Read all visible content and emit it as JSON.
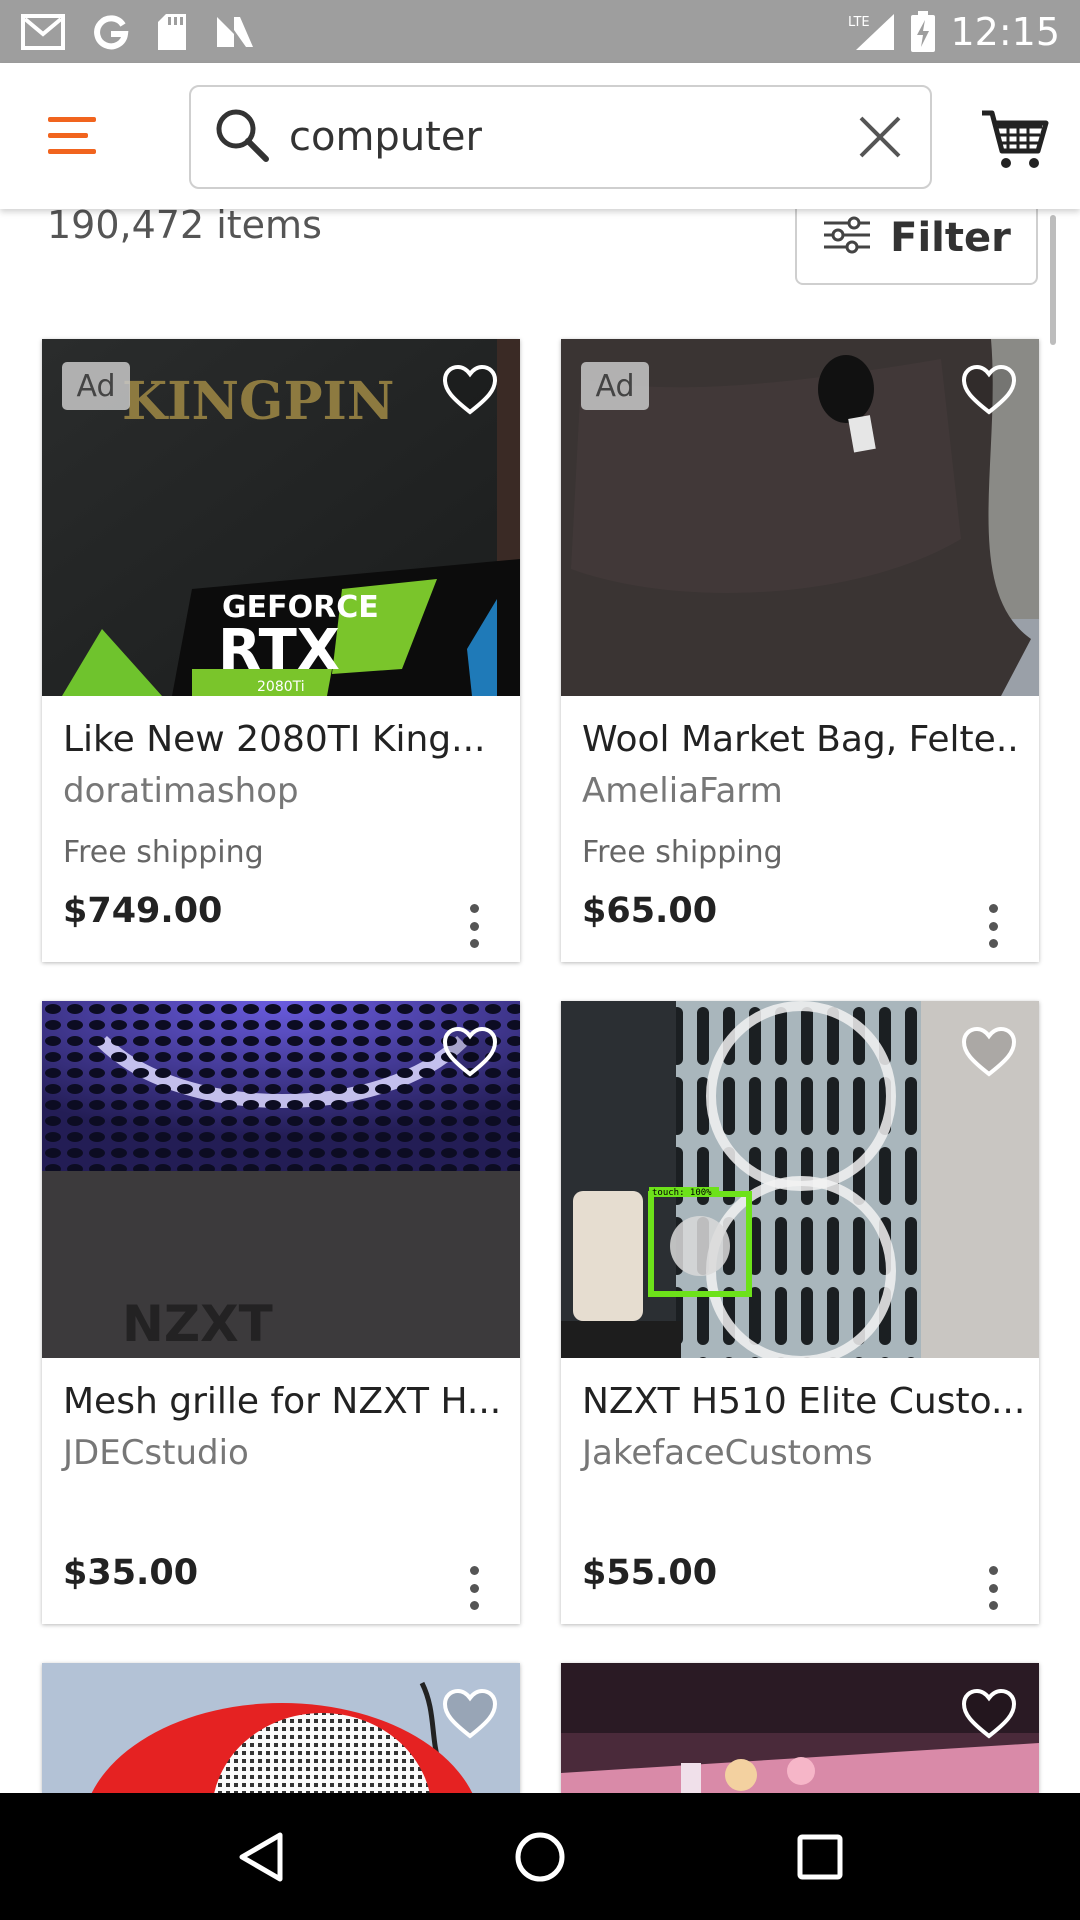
{
  "status_bar": {
    "time": "12:15",
    "network": "LTE",
    "icons": [
      "gmail-icon",
      "google-icon",
      "sd-card-icon",
      "n-app-icon"
    ]
  },
  "app_bar": {
    "menu_icon": "hamburger-menu-icon",
    "search": {
      "value": "computer",
      "icon": "search-icon",
      "clear_icon": "close-icon"
    },
    "cart_icon": "shopping-cart-icon",
    "accent_color": "#F1641E"
  },
  "results": {
    "count_label": "190,472 items",
    "filter_label": "Filter",
    "filter_icon": "sliders-icon"
  },
  "listings": [
    {
      "title": "Like New 2080TI King...",
      "shop": "doratimashop",
      "shipping": "Free shipping",
      "price": "$749.00",
      "ad": "Ad",
      "image": "gpu-box-photo"
    },
    {
      "title": "Wool Market Bag, Felte...",
      "shop": "AmeliaFarm",
      "shipping": "Free shipping",
      "price": "$65.00",
      "ad": "Ad",
      "image": "felt-bag-photo"
    },
    {
      "title": "Mesh grille for NZXT H...",
      "shop": "JDECstudio",
      "shipping": "",
      "price": "$35.00",
      "ad": "",
      "image": "nzxt-mesh-photo",
      "image_text": "NZXT"
    },
    {
      "title": "NZXT H510 Elite Custo...",
      "shop": "JakefaceCustoms",
      "shipping": "",
      "price": "$55.00",
      "ad": "",
      "image": "pc-case-photo",
      "overlay_text": "touch: 100%"
    },
    {
      "title": "",
      "shop": "",
      "shipping": "",
      "price": "",
      "ad": "",
      "image": "red-speaker-photo"
    },
    {
      "title": "",
      "shop": "",
      "shipping": "",
      "price": "",
      "ad": "",
      "image": "desk-setup-photo"
    }
  ],
  "gpu_box_text": {
    "brand": "KINGPIN",
    "line1": "GEFORCE",
    "line2": "RTX",
    "model": "2080Ti"
  },
  "nav_bar": {
    "back_icon": "back-triangle-icon",
    "home_icon": "home-circle-icon",
    "recents_icon": "recents-square-icon"
  }
}
